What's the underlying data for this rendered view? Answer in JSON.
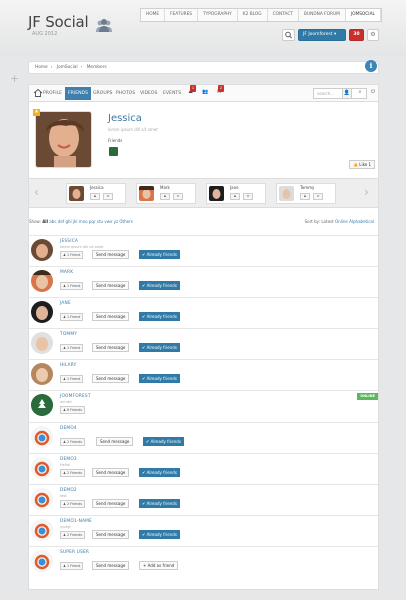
{
  "header": {
    "logo_title": "JF Social",
    "logo_sub": "AUG 2012",
    "nav": [
      "HOME",
      "FEATURES",
      "TYPOGRAPHY",
      "K2 BLOG",
      "CONTACT",
      "BUNDNA FORUM",
      "JOMSOCIAL"
    ],
    "user_button": "JF Joomforest",
    "notif_count": "30"
  },
  "breadcrumb": [
    "Home",
    "JomSocial",
    "Members"
  ],
  "toolbar": {
    "tabs": [
      "PROFILE",
      "FRIENDS",
      "GROUPS",
      "PHOTOS",
      "VIDEOS",
      "EVENTS"
    ],
    "badges": [
      "1",
      "2"
    ],
    "search_placeholder": "search..."
  },
  "profile": {
    "name": "Jessica",
    "status": "lorem ipsum dill sit amet",
    "friends_label": "Friends",
    "like_label": "Like 1"
  },
  "carousel": [
    "Jessica",
    "Mark",
    "Jane",
    "Tommy"
  ],
  "filter": {
    "show_label": "Show:",
    "all": "All",
    "letters": "abc def ghi jkl mno pqr stu vwx yz Others",
    "sort_label": "Sort by:",
    "sort_latest": "Latest",
    "sort_online": "Online",
    "sort_alpha": "Alphabetical"
  },
  "members": [
    {
      "name": "JESSICA",
      "status": "lorem ipsum dill sit amet",
      "friends": "1 Friend",
      "msg": "Send message",
      "action": "Already friends",
      "online": ""
    },
    {
      "name": "MARK",
      "status": "",
      "friends": "1 Friend",
      "msg": "Send message",
      "action": "Already friends",
      "online": ""
    },
    {
      "name": "JANE",
      "status": "",
      "friends": "1 Friend",
      "msg": "Send message",
      "action": "Already friends",
      "online": ""
    },
    {
      "name": "TOMMY",
      "status": "",
      "friends": "1 Friend",
      "msg": "Send message",
      "action": "Already friends",
      "online": ""
    },
    {
      "name": "HILARY",
      "status": "",
      "friends": "1 Friend",
      "msg": "Send message",
      "action": "Already friends",
      "online": ""
    },
    {
      "name": "JOOMFOREST",
      "status": "wrrrdd",
      "friends": "8 Friends",
      "msg": "",
      "action": "",
      "online": "ONLINE"
    },
    {
      "name": "DEMO4",
      "status": "",
      "friends": "2 Friends",
      "msg": "Send message",
      "action": "Already friends",
      "online": ""
    },
    {
      "name": "DEMO3",
      "status": "Hello!",
      "friends": "2 Friends",
      "msg": "Send message",
      "action": "Already friends",
      "online": ""
    },
    {
      "name": "DEMO2",
      "status": "test",
      "friends": "2 Friends",
      "msg": "Send message",
      "action": "Already friends",
      "online": ""
    },
    {
      "name": "DEMO1-NAME",
      "status": "xyzfgf",
      "friends": "2 Friends",
      "msg": "Send message",
      "action": "Already friends",
      "online": ""
    },
    {
      "name": "SUPER USER",
      "status": "",
      "friends": "1 Friend",
      "msg": "Send message",
      "action": "Add as friend",
      "online": ""
    }
  ],
  "colors": {
    "accent": "#3e7fae",
    "online": "#5cb85c",
    "notif": "#c9302c"
  }
}
